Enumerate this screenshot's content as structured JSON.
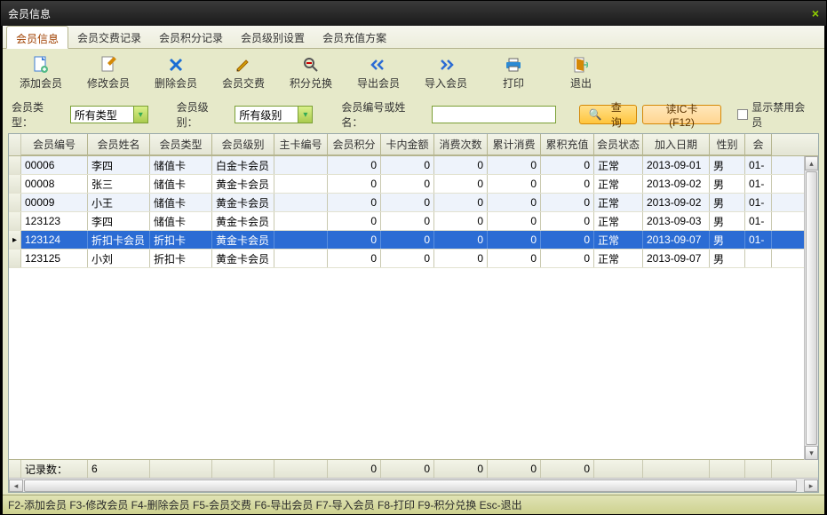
{
  "window": {
    "title": "会员信息",
    "close_glyph": "×"
  },
  "tabs": [
    {
      "label": "会员信息",
      "active": true
    },
    {
      "label": "会员交费记录",
      "active": false
    },
    {
      "label": "会员积分记录",
      "active": false
    },
    {
      "label": "会员级别设置",
      "active": false
    },
    {
      "label": "会员充值方案",
      "active": false
    }
  ],
  "toolbar": [
    {
      "id": "add",
      "label": "添加会员",
      "icon": "file-add",
      "color": "#3a7bd5"
    },
    {
      "id": "edit",
      "label": "修改会员",
      "icon": "file-edit",
      "color": "#d48806"
    },
    {
      "id": "delete",
      "label": "删除会员",
      "icon": "cross",
      "color": "#1a6dd4"
    },
    {
      "id": "pay",
      "label": "会员交费",
      "icon": "pencil",
      "color": "#d4a106"
    },
    {
      "id": "points",
      "label": "积分兑换",
      "icon": "search-minus",
      "color": "#555"
    },
    {
      "id": "export",
      "label": "导出会员",
      "icon": "chev-left",
      "color": "#2b6cd4"
    },
    {
      "id": "import",
      "label": "导入会员",
      "icon": "chev-right",
      "color": "#2b6cd4"
    },
    {
      "id": "print",
      "label": "打印",
      "icon": "printer",
      "color": "#2b8ad4"
    },
    {
      "id": "exit",
      "label": "退出",
      "icon": "door",
      "color": "#d48806"
    }
  ],
  "filter": {
    "type_label": "会员类型：",
    "type_value": "所有类型",
    "level_label": "会员级别：",
    "level_value": "所有级别",
    "search_label": "会员编号或姓名：",
    "search_value": "",
    "query_btn": "查询",
    "readic_btn": "读IC卡 (F12)",
    "show_disabled_label": "显示禁用会员"
  },
  "grid": {
    "headers": [
      "会员编号",
      "会员姓名",
      "会员类型",
      "会员级别",
      "主卡编号",
      "会员积分",
      "卡内金额",
      "消费次数",
      "累计消费",
      "累积充值",
      "会员状态",
      "加入日期",
      "性别",
      "会"
    ],
    "rows": [
      {
        "id": "00006",
        "name": "李四",
        "type": "储值卡",
        "level": "白金卡会员",
        "card": "",
        "points": "0",
        "bal": "0",
        "count": "0",
        "cum": "0",
        "rech": "0",
        "stat": "正常",
        "date": "2013-09-01",
        "sex": "男",
        "extra": "01-"
      },
      {
        "id": "00008",
        "name": "张三",
        "type": "储值卡",
        "level": "黄金卡会员",
        "card": "",
        "points": "0",
        "bal": "0",
        "count": "0",
        "cum": "0",
        "rech": "0",
        "stat": "正常",
        "date": "2013-09-02",
        "sex": "男",
        "extra": "01-"
      },
      {
        "id": "00009",
        "name": "小王",
        "type": "储值卡",
        "level": "黄金卡会员",
        "card": "",
        "points": "0",
        "bal": "0",
        "count": "0",
        "cum": "0",
        "rech": "0",
        "stat": "正常",
        "date": "2013-09-02",
        "sex": "男",
        "extra": "01-"
      },
      {
        "id": "123123",
        "name": "李四",
        "type": "储值卡",
        "level": "黄金卡会员",
        "card": "",
        "points": "0",
        "bal": "0",
        "count": "0",
        "cum": "0",
        "rech": "0",
        "stat": "正常",
        "date": "2013-09-03",
        "sex": "男",
        "extra": "01-"
      },
      {
        "id": "123124",
        "name": "折扣卡会员",
        "type": "折扣卡",
        "level": "黄金卡会员",
        "card": "",
        "points": "0",
        "bal": "0",
        "count": "0",
        "cum": "0",
        "rech": "0",
        "stat": "正常",
        "date": "2013-09-07",
        "sex": "男",
        "extra": "01-",
        "selected": true
      },
      {
        "id": "123125",
        "name": "小刘",
        "type": "折扣卡",
        "level": "黄金卡会员",
        "card": "",
        "points": "0",
        "bal": "0",
        "count": "0",
        "cum": "0",
        "rech": "0",
        "stat": "正常",
        "date": "2013-09-07",
        "sex": "男",
        "extra": ""
      }
    ],
    "footer": {
      "label": "记录数：",
      "count": "6",
      "sums": {
        "points": "0",
        "bal": "0",
        "count": "0",
        "cum": "0",
        "rech": "0"
      }
    }
  },
  "statusbar": "F2-添加会员 F3-修改会员 F4-删除会员 F5-会员交费 F6-导出会员 F7-导入会员 F8-打印 F9-积分兑换 Esc-退出"
}
